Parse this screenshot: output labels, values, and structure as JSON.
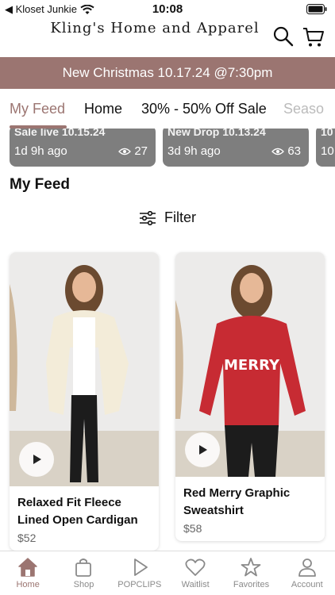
{
  "status": {
    "carrier": "◀ Kloset Junkie",
    "time": "10:08"
  },
  "header": {
    "logo": "Kling's Home and Apparel",
    "search_icon": "search-icon",
    "cart_icon": "cart-icon"
  },
  "announcement": {
    "text": "New Christmas 10.17.24 @7:30pm"
  },
  "tabs": [
    {
      "label": "My Feed",
      "active": true
    },
    {
      "label": "Home"
    },
    {
      "label": "30% - 50% Off Sale"
    },
    {
      "label": "Seaso"
    }
  ],
  "top_cards": [
    {
      "title": "Sale live 10.15.24",
      "time": "1d 9h ago",
      "views": "27"
    },
    {
      "title": "New Drop 10.13.24",
      "time": "3d 9h ago",
      "views": "63"
    },
    {
      "title": "10",
      "time": "10"
    }
  ],
  "feed": {
    "title": "My Feed",
    "filter_label": "Filter"
  },
  "products": [
    {
      "name": "Relaxed Fit Fleece Lined Open Cardigan",
      "price": "$52",
      "top_color": "#f3ecd9",
      "bottom_color": "#1c1c1c"
    },
    {
      "name": "Red Merry Graphic Sweatshirt",
      "price": "$58",
      "top_color": "#c72b33",
      "bottom_color": "#1c1c1c",
      "graphic_text": "MERRY"
    }
  ],
  "bottom_nav": [
    {
      "label": "Home",
      "icon": "home-icon",
      "active": true
    },
    {
      "label": "Shop",
      "icon": "shopping-bag-icon"
    },
    {
      "label": "POPCLIPS",
      "icon": "play-icon"
    },
    {
      "label": "Waitlist",
      "icon": "heart-icon"
    },
    {
      "label": "Favorites",
      "icon": "star-icon"
    },
    {
      "label": "Account",
      "icon": "person-icon"
    }
  ],
  "colors": {
    "accent": "#9b7571",
    "announce_bg": "#9b7571"
  }
}
